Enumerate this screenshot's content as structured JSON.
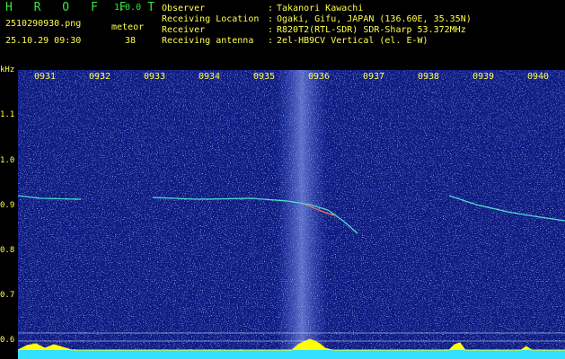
{
  "header": {
    "logo": "H R O F F T",
    "version": "1.0.0",
    "filename": "2510290930.png",
    "meteor_label": "meteor",
    "datetime": "25.10.29 09:30",
    "meteor_count": "38"
  },
  "info": [
    {
      "key": "Observer",
      "value": "Takanori Kawachi"
    },
    {
      "key": "Receiving Location",
      "value": "Ogaki, Gifu, JAPAN (136.60E, 35.35N)"
    },
    {
      "key": "Receiver",
      "value": "R820T2(RTL-SDR) SDR-Sharp 53.372MHz"
    },
    {
      "key": "Receiving antenna",
      "value": "2el-HB9CV Vertical (el. E-W)"
    }
  ],
  "axis": {
    "y_unit": "kHz",
    "y_ticks": [
      "1.1",
      "1.0",
      "0.9",
      "0.8",
      "0.7",
      "0.6"
    ],
    "x_ticks": [
      "0931",
      "0932",
      "0933",
      "0934",
      "0935",
      "0936",
      "0937",
      "0938",
      "0939",
      "0940"
    ]
  },
  "colors": {
    "background": "#000000",
    "spectrogram": "#0d1a82",
    "text": "#ffff4d",
    "logo": "#39e639",
    "trace": "#4fe0d0",
    "baseline": "#33e0ff",
    "activity": "#ffff00"
  }
}
